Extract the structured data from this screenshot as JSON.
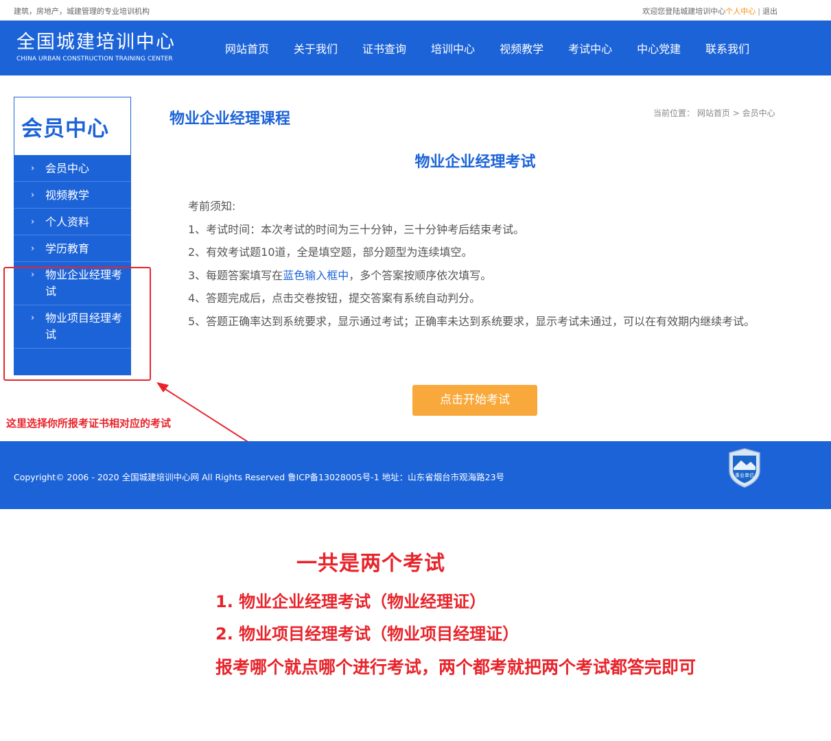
{
  "topbar": {
    "slogan": "建筑，房地产，城建管理的专业培训机构",
    "welcome": "欢迎您登陆城建培训中心",
    "member_center": "个人中心",
    "separator": "|",
    "logout": "退出"
  },
  "header": {
    "logo_cn": "全国城建培训中心",
    "logo_en": "CHINA URBAN CONSTRUCTION TRAINING CENTER",
    "nav": [
      "网站首页",
      "关于我们",
      "证书查询",
      "培训中心",
      "视频教学",
      "考试中心",
      "中心党建",
      "联系我们"
    ]
  },
  "sidebar": {
    "title": "会员中心",
    "items": [
      "会员中心",
      "视频教学",
      "个人资料",
      "学历教育",
      "物业企业经理考试",
      "物业项目经理考试"
    ]
  },
  "main": {
    "title": "物业企业经理课程",
    "breadcrumb": {
      "prefix": "当前位置：",
      "home": "网站首页",
      "sep": ">",
      "current": "会员中心"
    },
    "exam_title": "物业企业经理考试",
    "notice": {
      "heading": "考前须知:",
      "item1": "1、考试时间：本次考试的时间为三十分钟，三十分钟考后结束考试。",
      "item2": "2、有效考试题10道，全是填空题，部分题型为连续填空。",
      "item3_a": "3、每题答案填写在",
      "item3_b": "蓝色输入框中",
      "item3_c": "，多个答案按顺序依次填写。",
      "item4": "4、答题完成后，点击交卷按钮，提交答案有系统自动判分。",
      "item5": "5、答题正确率达到系统要求，显示通过考试；正确率未达到系统要求，显示考试未通过，可以在有效期内继续考试。"
    },
    "start_button": "点击开始考试"
  },
  "annotations": {
    "sidebar_hint": "这里选择你所报考证书相对应的考试",
    "heading": "一共是两个考试",
    "line1": "1. 物业企业经理考试（物业经理证）",
    "line2": "2. 物业项目经理考试（物业项目经理证）",
    "line3": "报考哪个就点哪个进行考试，两个都考就把两个考试都答完即可"
  },
  "footer": {
    "copyright": "Copyright© 2006 - 2020 全国城建培训中心网 All Rights Reserved 鲁ICP备13028005号-1 地址：山东省烟台市观海路23号",
    "badge_text": "事业单位"
  },
  "colors": {
    "brand_blue": "#1c63d8",
    "accent_orange": "#f9a93b",
    "annotation_red": "#e8232a"
  }
}
